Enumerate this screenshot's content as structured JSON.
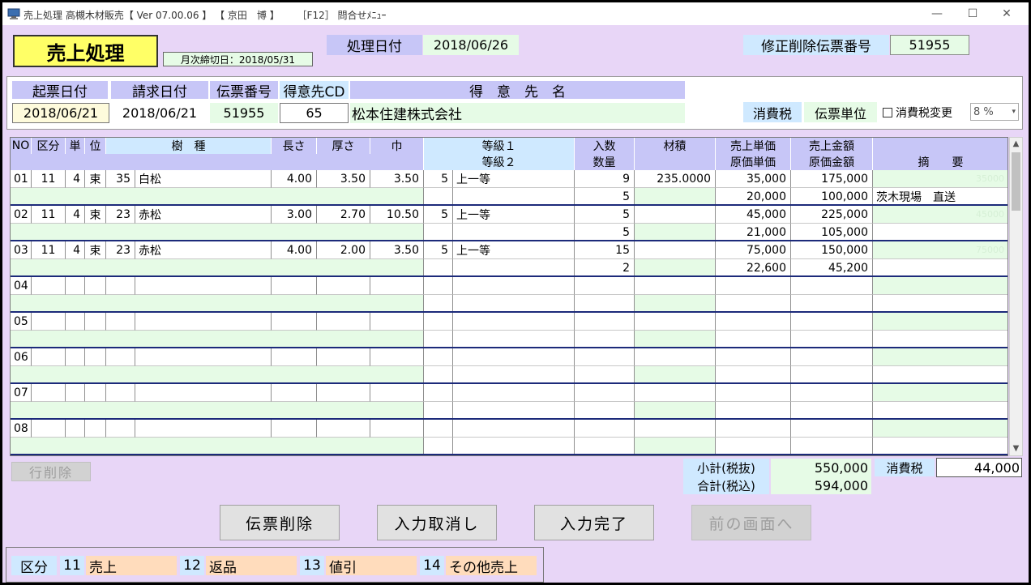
{
  "window": {
    "title": "売上処理 高槻木材販売【 Ver 07.00.06 】 【 京田　博 】　　 ［F12］ 問合せﾒﾆｭｰ",
    "minimize": "—",
    "maximize": "☐",
    "close": "✕"
  },
  "header": {
    "screen_title": "売上処理",
    "closing_date": "月次締切日：2018/05/31",
    "process_date_label": "処理日付",
    "process_date": "2018/06/26",
    "edit_slip_label": "修正削除伝票番号",
    "edit_slip_no": "51955"
  },
  "slip": {
    "issue_date_label": "起票日付",
    "issue_date": "2018/06/21",
    "bill_date_label": "請求日付",
    "bill_date": "2018/06/21",
    "slip_no_label": "伝票番号",
    "slip_no": "51955",
    "cust_cd_label": "得意先CD",
    "cust_cd": "65",
    "cust_name_label": "得　意　先　名",
    "cust_name": "松本住建株式会社",
    "tax_label": "消費税",
    "tax_unit": "伝票単位",
    "tax_change_label": "消費税変更",
    "tax_rate": "8 %"
  },
  "grid": {
    "headers": {
      "no": "NO",
      "kubun": "区分",
      "tan": "単",
      "i": "位",
      "jushu": "樹　種",
      "nagasa": "長さ",
      "atsusa": "厚さ",
      "haba": "巾",
      "tokyu1": "等級１",
      "tokyu2": "等級２",
      "irisu": "入数",
      "suryo": "数量",
      "zaiseki": "材積",
      "uri_tanka": "売上単価",
      "gen_tanka": "原価単価",
      "uri_kingaku": "売上金額",
      "gen_kingaku": "原価金額",
      "tekiyo": "摘　　要"
    },
    "rows": [
      {
        "no": "01",
        "kubun": "11",
        "unit_cd": "4",
        "unit": "束",
        "sp_cd": "35",
        "species": "白松",
        "len": "4.00",
        "thk": "3.50",
        "wid": "3.50",
        "g_cd": "5",
        "grade": "上一等",
        "irisu": "9",
        "zaiseki": "235.0000",
        "uri_tanka": "35,000",
        "uri_kingaku": "175,000",
        "suryo": "5",
        "gen_tanka": "20,000",
        "gen_kingaku": "100,000",
        "tekiyo": "茨木現場　直送",
        "faint": "35000"
      },
      {
        "no": "02",
        "kubun": "11",
        "unit_cd": "4",
        "unit": "束",
        "sp_cd": "23",
        "species": "赤松",
        "len": "3.00",
        "thk": "2.70",
        "wid": "10.50",
        "g_cd": "5",
        "grade": "上一等",
        "irisu": "5",
        "zaiseki": "",
        "uri_tanka": "45,000",
        "uri_kingaku": "225,000",
        "suryo": "5",
        "gen_tanka": "21,000",
        "gen_kingaku": "105,000",
        "tekiyo": "",
        "faint": "45000"
      },
      {
        "no": "03",
        "kubun": "11",
        "unit_cd": "4",
        "unit": "束",
        "sp_cd": "23",
        "species": "赤松",
        "len": "4.00",
        "thk": "2.00",
        "wid": "3.50",
        "g_cd": "5",
        "grade": "上一等",
        "irisu": "15",
        "zaiseki": "",
        "uri_tanka": "75,000",
        "uri_kingaku": "150,000",
        "suryo": "2",
        "gen_tanka": "22,600",
        "gen_kingaku": "45,200",
        "tekiyo": "",
        "faint": "75000"
      },
      {
        "no": "04"
      },
      {
        "no": "05"
      },
      {
        "no": "06"
      },
      {
        "no": "07"
      },
      {
        "no": "08"
      }
    ]
  },
  "footer": {
    "delete_row": "行削除",
    "subtotal_label": "小計(税抜)",
    "subtotal": "550,000",
    "tax_label": "消費税",
    "tax": "44,000",
    "total_label": "合計(税込)",
    "total": "594,000"
  },
  "actions": {
    "delete_slip": "伝票削除",
    "cancel_input": "入力取消し",
    "complete": "入力完了",
    "back": "前の画面へ"
  },
  "legend": {
    "label": "区分",
    "items": [
      {
        "code": "11",
        "name": "売上"
      },
      {
        "code": "12",
        "name": "返品"
      },
      {
        "code": "13",
        "name": "値引"
      },
      {
        "code": "14",
        "name": "その他売上"
      }
    ]
  },
  "colors": {
    "header": "#c7c6f7",
    "value": "#e6fbe6",
    "label": "#cfe9ff",
    "title_yellow": "#ffff66",
    "row_separator": "#1c2a7a",
    "legend_item": "#ffdcbc",
    "background": "#e8d6f7"
  }
}
